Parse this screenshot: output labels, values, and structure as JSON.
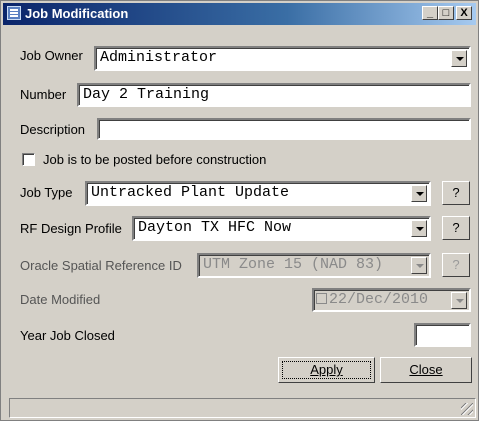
{
  "window": {
    "title": "Job Modification"
  },
  "form": {
    "job_owner": {
      "label": "Job Owner",
      "value": "Administrator"
    },
    "number": {
      "label": "Number",
      "value": "Day 2 Training"
    },
    "description": {
      "label": "Description",
      "value": ""
    },
    "posted_checkbox": {
      "label": "Job is to be posted before construction",
      "checked": false
    },
    "job_type": {
      "label": "Job Type",
      "value": "Untracked Plant Update",
      "help": "?"
    },
    "rf_design_profile": {
      "label": "RF Design Profile",
      "value": "Dayton TX HFC Now",
      "help": "?"
    },
    "oracle_srid": {
      "label": "Oracle Spatial Reference ID",
      "value": "UTM Zone 15 (NAD 83)",
      "help": "?"
    },
    "date_modified": {
      "label": "Date Modified",
      "value": "22/Dec/2010"
    },
    "year_job_closed": {
      "label": "Year Job Closed",
      "value": ""
    }
  },
  "buttons": {
    "apply": "Apply",
    "close": "Close"
  },
  "titlebar_buttons": {
    "minimize": "_",
    "maximize": "□",
    "close": "X"
  }
}
